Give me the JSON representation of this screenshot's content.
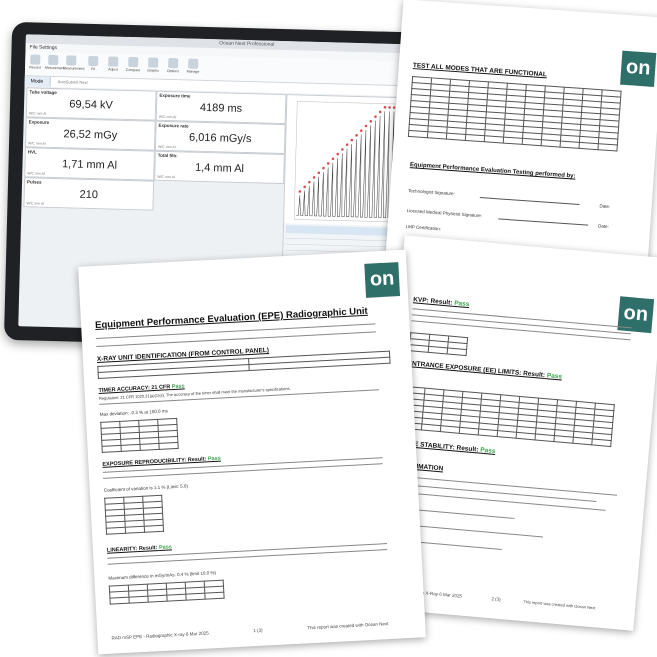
{
  "app": {
    "window_title": "Ocean Next Professional",
    "menu": "File  Settings",
    "toolbar": [
      "Record",
      "Mesurement",
      "Measurement",
      "Fit",
      "Adjust",
      "Compare",
      "Graphs",
      "Options",
      "Manage"
    ],
    "tab": "Mode",
    "subtab": "AutoSubmit  Next",
    "panels": [
      {
        "label": "Tube voltage",
        "value": "69,54 kV",
        "sub": "W/C mm Al"
      },
      {
        "label": "Exposure time",
        "value": "4189 ms",
        "sub": "W/C mm Al"
      },
      {
        "label": "Exposure",
        "value": "26,52 mGy",
        "sub": "W/C mm Al"
      },
      {
        "label": "Exposure rate",
        "value": "6,016 mGy/s",
        "sub": "W/C mm Al"
      },
      {
        "label": "HVL",
        "value": "1,71 mm Al",
        "sub": "W/C mm Al"
      },
      {
        "label": "Total filtr.",
        "value": "1,4 mm Al",
        "sub": "W/C mm Al"
      },
      {
        "label": "Pulses",
        "value": "210",
        "sub": "W/C mm Al"
      }
    ]
  },
  "brand": {
    "logo_text": "on",
    "logo_color": "#2e6f6a",
    "pass_color": "#3aa34a"
  },
  "doc_front": {
    "title": "Equipment Performance Evaluation (EPE) Radiographic Unit",
    "section1": "X-RAY UNIT IDENTIFICATION (FROM CONTROL PANEL)",
    "kvp_heading": "TIMER ACCURACY: 21 CFR",
    "kvp_result": "Pass",
    "regulation": "Regulation: 21 CFR 1020.31(a)(1)(ii). The accuracy of the timer shall meet the manufacturer's specifications.",
    "max_dev": "Max deviation: -0.3 % at 100.0 ms",
    "repro_heading": "EXPOSURE REPRODUCIBILITY: Result:",
    "repro_result": "Pass",
    "coeff": "Coefficient of variation is 1.1 % (Limit: 5.0)",
    "linearity_heading": "LINEARITY: Result:",
    "linearity_result": "Pass",
    "max_diff": "Maximum difference in mGy/mAs: 0.4 % (limit 10.0 %)",
    "footer_left": "RAD mSP EPE - Radiographic X-ray 6 Mar 2025",
    "footer_page": "1 (3)",
    "footer_right": "This report was created with Ocean Next"
  },
  "doc_back_top": {
    "title": "TEST ALL MODES THAT ARE FUNCTIONAL",
    "section": "Equipment Performance Evaluation Testing performed by:",
    "sign1": "Technologist Signature:",
    "sign2": "Licensed Medical Physicist Signature:",
    "sign3": "LMP Certification:",
    "date": "Date:"
  },
  "doc_back_right": {
    "kvp_heading": "KVP: Result:",
    "kvp_result": "Pass",
    "exposure_heading": "ENTRANCE EXPOSURE (EE) LIMITS: Result:",
    "exposure_result": "Pass",
    "tube_heading": "TUBE STABILITY: Result:",
    "tube_result": "Pass",
    "collimation_heading": "COLLIMATION",
    "footer_left": "EPE - Washington X-Ray 6 Mar 2025",
    "footer_page": "2 (3)",
    "footer_right": "This report was created with Ocean Next"
  }
}
